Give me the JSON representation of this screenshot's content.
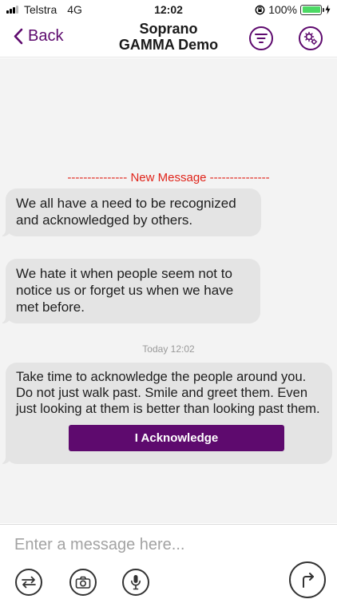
{
  "status_bar": {
    "carrier": "Telstra",
    "network": "4G",
    "time": "12:02",
    "battery": "100%",
    "battery_level": 1.0,
    "battery_color": "#4cd964"
  },
  "header": {
    "back_label": "Back",
    "title_line1": "Soprano",
    "title_line2": "GAMMA Demo",
    "icons": [
      "chevron-left-icon",
      "filter-icon",
      "settings-icon"
    ],
    "accent_color": "#5e0a6e"
  },
  "chat": {
    "new_message_divider": "--------------- New Message ---------------",
    "messages": [
      {
        "text": "We all have a need to be recognized and acknowledged by others."
      },
      {
        "text": "We hate it when people seem not to notice us or forget us when we have met before."
      },
      {
        "text": "Take time to acknowledge the people around you. Do not just walk past. Smile and greet them. Even just looking at them is better than looking past them.",
        "action_label": "I Acknowledge"
      }
    ],
    "timestamp": "Today 12:02"
  },
  "composer": {
    "placeholder": "Enter a message here...",
    "icons": [
      "swap-icon",
      "camera-icon",
      "microphone-icon",
      "send-icon"
    ]
  }
}
